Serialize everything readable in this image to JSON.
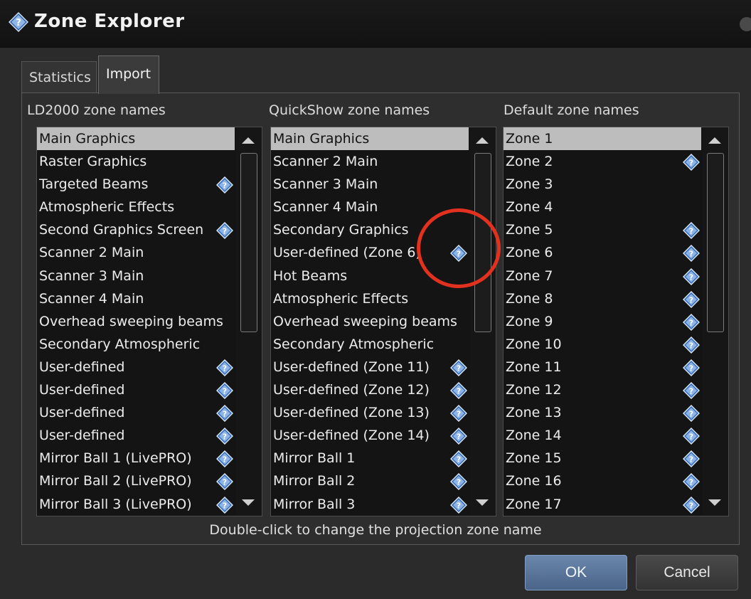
{
  "window": {
    "title": "Zone Explorer",
    "icon": "help-diamond-icon"
  },
  "tabs": [
    {
      "label": "Statistics",
      "active": false
    },
    {
      "label": "Import",
      "active": true
    }
  ],
  "columns": [
    {
      "header": "LD2000 zone names",
      "rows": [
        {
          "label": "Main Graphics",
          "selected": true,
          "help": false
        },
        {
          "label": "Raster Graphics",
          "help": false
        },
        {
          "label": "Targeted Beams",
          "help": true
        },
        {
          "label": "Atmospheric Effects",
          "help": false
        },
        {
          "label": "Second Graphics Screen",
          "help": true
        },
        {
          "label": "Scanner 2 Main",
          "help": false
        },
        {
          "label": "Scanner 3 Main",
          "help": false
        },
        {
          "label": "Scanner 4 Main",
          "help": false
        },
        {
          "label": "Overhead sweeping beams",
          "help": false
        },
        {
          "label": "Secondary Atmospheric",
          "help": false
        },
        {
          "label": "User-defined",
          "help": true
        },
        {
          "label": "User-defined",
          "help": true
        },
        {
          "label": "User-defined",
          "help": true
        },
        {
          "label": "User-defined",
          "help": true
        },
        {
          "label": "Mirror Ball 1 (LivePRO)",
          "help": true
        },
        {
          "label": "Mirror Ball 2 (LivePRO)",
          "help": true
        },
        {
          "label": "Mirror Ball 3 (LivePRO)",
          "help": true
        }
      ]
    },
    {
      "header": "QuickShow zone names",
      "rows": [
        {
          "label": "Main Graphics",
          "selected": true,
          "help": false
        },
        {
          "label": "Scanner 2 Main",
          "help": false
        },
        {
          "label": "Scanner 3 Main",
          "help": false
        },
        {
          "label": "Scanner 4 Main",
          "help": false
        },
        {
          "label": "Secondary Graphics",
          "help": false
        },
        {
          "label": "User-defined (Zone 6)",
          "help": true
        },
        {
          "label": "Hot Beams",
          "help": false
        },
        {
          "label": "Atmospheric Effects",
          "help": false
        },
        {
          "label": "Overhead sweeping beams",
          "help": false
        },
        {
          "label": "Secondary Atmospheric",
          "help": false
        },
        {
          "label": "User-defined (Zone 11)",
          "help": true
        },
        {
          "label": "User-defined (Zone 12)",
          "help": true
        },
        {
          "label": "User-defined (Zone 13)",
          "help": true
        },
        {
          "label": "User-defined (Zone 14)",
          "help": true
        },
        {
          "label": "Mirror Ball 1",
          "help": true
        },
        {
          "label": "Mirror Ball 2",
          "help": true
        },
        {
          "label": "Mirror Ball 3",
          "help": true
        }
      ]
    },
    {
      "header": "Default zone names",
      "rows": [
        {
          "label": "Zone 1",
          "selected": true,
          "help": false
        },
        {
          "label": "Zone 2",
          "help": true
        },
        {
          "label": "Zone 3",
          "help": false
        },
        {
          "label": "Zone 4",
          "help": false
        },
        {
          "label": "Zone 5",
          "help": true
        },
        {
          "label": "Zone 6",
          "help": true
        },
        {
          "label": "Zone 7",
          "help": true
        },
        {
          "label": "Zone 8",
          "help": true
        },
        {
          "label": "Zone 9",
          "help": true
        },
        {
          "label": "Zone 10",
          "help": true
        },
        {
          "label": "Zone 11",
          "help": true
        },
        {
          "label": "Zone 12",
          "help": true
        },
        {
          "label": "Zone 13",
          "help": true
        },
        {
          "label": "Zone 14",
          "help": true
        },
        {
          "label": "Zone 15",
          "help": true
        },
        {
          "label": "Zone 16",
          "help": true
        },
        {
          "label": "Zone 17",
          "help": true
        }
      ]
    }
  ],
  "hint": "Double-click to change the projection zone name",
  "buttons": {
    "ok": "OK",
    "cancel": "Cancel"
  },
  "colors": {
    "accent_button": "#5a7499",
    "help_icon": "#6f9bd6",
    "selection": "#bdbdbd",
    "annotation": "#e3311f"
  }
}
